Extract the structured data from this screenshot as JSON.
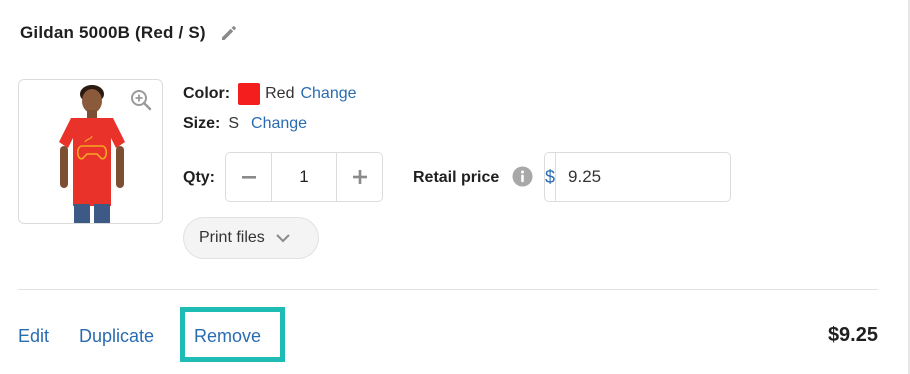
{
  "product": {
    "title": "Gildan 5000B (Red / S)",
    "color_label": "Color:",
    "color_value": "Red",
    "color_hex": "#f41e1e",
    "size_label": "Size:",
    "size_value": "S",
    "change_label": "Change"
  },
  "quantity": {
    "label": "Qty:",
    "value": "1"
  },
  "retail": {
    "label": "Retail price",
    "currency": "$",
    "value": "9.25"
  },
  "print_files": {
    "label": "Print files"
  },
  "actions": {
    "edit": "Edit",
    "duplicate": "Duplicate",
    "remove": "Remove"
  },
  "total": "$9.25",
  "colors": {
    "link": "#2a6cb0",
    "highlight": "#1ebcb4",
    "shirt": "#e8322a"
  }
}
